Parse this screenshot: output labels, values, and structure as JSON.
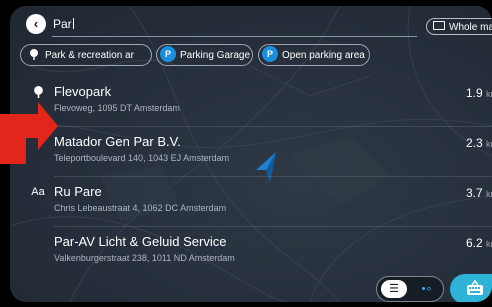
{
  "search": {
    "query": "Par"
  },
  "header": {
    "back_icon": "chevron-left-icon",
    "whole_map_label": "Whole map"
  },
  "filters": [
    {
      "label": "Park & recreation ar",
      "icon": "tree-icon"
    },
    {
      "label": "Parking Garage",
      "icon": "parking-garage-icon",
      "glyph": "P"
    },
    {
      "label": "Open parking area",
      "icon": "parking-icon",
      "glyph": "P"
    }
  ],
  "results": [
    {
      "name": "Flevopark",
      "address": "Flevoweg, 1095 DT Amsterdam",
      "distance": "1.9",
      "unit": "km",
      "icon": "tree-icon"
    },
    {
      "name": "Matador Gen Par B.V.",
      "address": "Teleportboulevard 140, 1043 EJ Amsterdam",
      "distance": "2.3",
      "unit": "km",
      "icon": ""
    },
    {
      "name": "Ru Pare",
      "address": "Chris Lebeaustraat 4, 1062 DC Amsterdam",
      "distance": "3.7",
      "unit": "km",
      "icon": "Aa"
    },
    {
      "name": "Par-AV Licht & Geluid Service",
      "address": "Valkenburgerstraat 238, 1011 ND Amsterdam",
      "distance": "6.2",
      "unit": "km",
      "icon": ""
    }
  ],
  "colors": {
    "accent": "#1a8fe0",
    "nav_button": "#2fb2d8",
    "annotation_arrow": "#e3261c"
  }
}
